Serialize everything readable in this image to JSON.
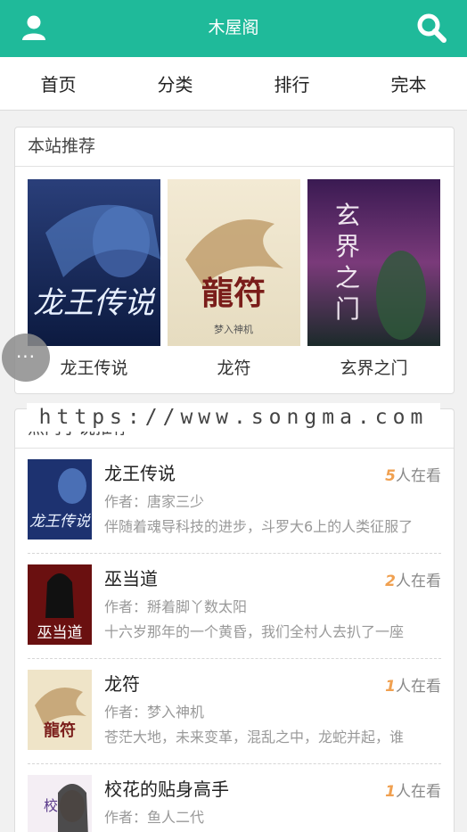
{
  "header": {
    "title": "木屋阁",
    "user_icon": "user-icon",
    "search_icon": "search-icon",
    "bg_color": "#1fba9a"
  },
  "nav": {
    "items": [
      "首页",
      "分类",
      "排行",
      "完本"
    ]
  },
  "recommend": {
    "heading": "本站推荐",
    "books": [
      {
        "name": "龙王传说",
        "cover_text": "龙王传说"
      },
      {
        "name": "龙符",
        "cover_text": "龍符"
      },
      {
        "name": "玄界之门",
        "cover_text": "玄界之门"
      }
    ]
  },
  "hot": {
    "heading": "热门小说推荐",
    "books": [
      {
        "title": "龙王传说",
        "reading_num": "5",
        "reading_suffix": "人在看",
        "author": "作者：唐家三少",
        "intro": "伴随着魂导科技的进步，斗罗大6上的人类征服了"
      },
      {
        "title": "巫当道",
        "reading_num": "2",
        "reading_suffix": "人在看",
        "author": "作者：掰着脚丫数太阳",
        "intro": "十六岁那年的一个黄昏，我们全村人去扒了一座"
      },
      {
        "title": "龙符",
        "reading_num": "1",
        "reading_suffix": "人在看",
        "author": "作者：梦入神机",
        "intro": "苍茫大地，未来变革，混乱之中，龙蛇并起，谁"
      },
      {
        "title": "校花的贴身高手",
        "reading_num": "1",
        "reading_suffix": "人在看",
        "author": "作者：鱼人二代",
        "intro": ""
      }
    ]
  },
  "watermark": "https://www.songma.com",
  "float_menu": {
    "dots": "···"
  }
}
